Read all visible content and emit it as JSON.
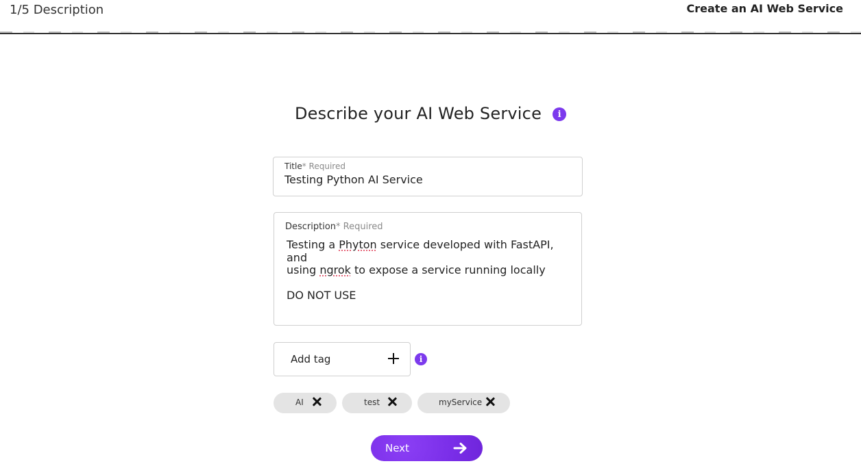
{
  "header": {
    "step": "1/5 Description",
    "app_title": "Create an AI Web Service"
  },
  "page": {
    "title": "Describe your AI Web Service"
  },
  "form": {
    "title_field": {
      "label": "Title",
      "required": "* Required",
      "value": "Testing Python AI Service"
    },
    "description_field": {
      "label": "Description",
      "required": "* Required",
      "value_parts": [
        "Testing a ",
        "Phyton",
        " service developed with FastAPI, and\nusing ",
        "ngrok",
        " to expose a service running locally\n\nDO NOT USE"
      ]
    },
    "tag_input": {
      "placeholder": "Add tag"
    },
    "tags": [
      "AI",
      "test",
      "myService"
    ]
  },
  "actions": {
    "next_label": "Next"
  },
  "icons": {
    "info": "info-icon",
    "add": "plus-icon",
    "remove": "close-icon",
    "next": "arrow-right-icon"
  },
  "colors": {
    "accent": "#7c3aed",
    "chip_bg": "#e4e4e4",
    "border": "#cfcfcf"
  }
}
